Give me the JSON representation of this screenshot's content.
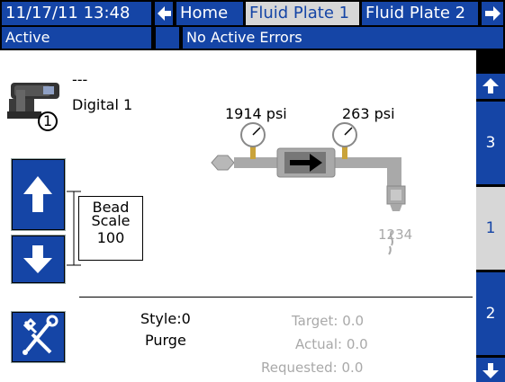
{
  "header": {
    "datetime": "11/17/11 13:48",
    "back_arrow": "←",
    "tabs": [
      {
        "label": "Home"
      },
      {
        "label": "Fluid Plate 1",
        "selected": true
      },
      {
        "label": "Fluid Plate 2"
      }
    ],
    "forward_arrow": "→"
  },
  "status": {
    "state": "Active",
    "errors": "No Active Errors"
  },
  "device": {
    "name_line1": "---",
    "name_line2": "Digital 1",
    "badge": "1"
  },
  "pressures": {
    "inlet": "1914 psi",
    "outlet": "263 psi"
  },
  "gun_numbers": "1234",
  "bead_scale": {
    "line1": "Bead",
    "line2": "Scale",
    "value": "100"
  },
  "bottom": {
    "style": "Style:0",
    "mode": "Purge",
    "target": "Target: 0.0",
    "actual": "Actual: 0.0",
    "requested": "Requested: 0.0"
  },
  "right_tabs": [
    {
      "label": "3"
    },
    {
      "label": "1",
      "selected": true
    },
    {
      "label": "2"
    }
  ],
  "colors": {
    "accent": "#1545a6",
    "selected_tab": "#d7d7d7",
    "disabled_text": "#a9a9a9"
  }
}
